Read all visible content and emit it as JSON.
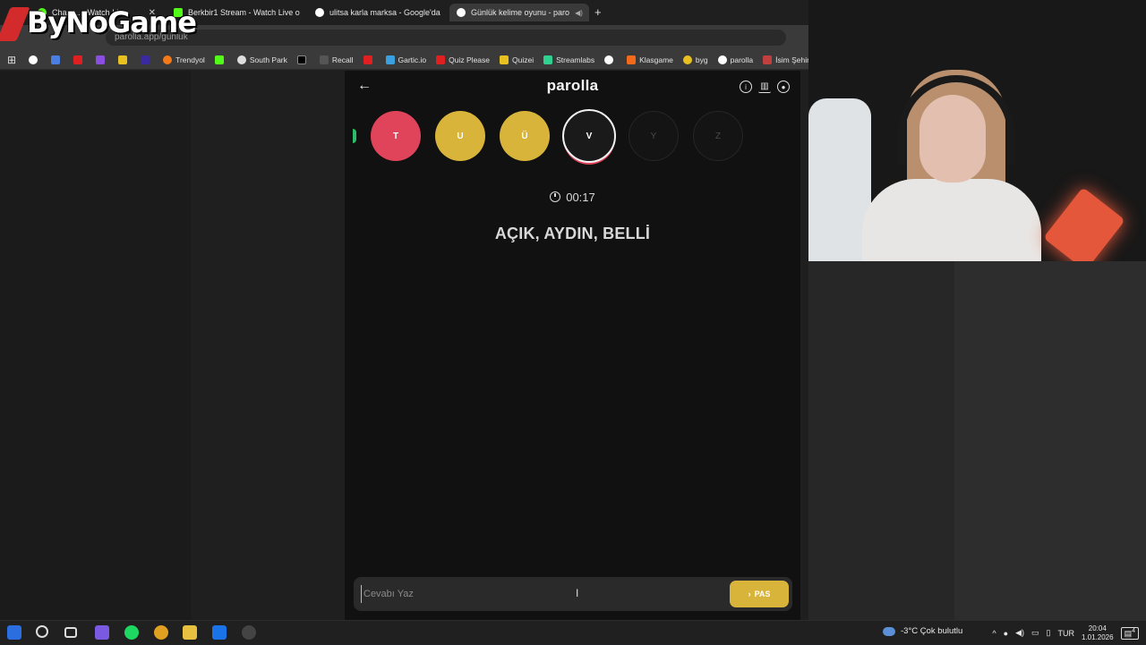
{
  "browser": {
    "tabs": [
      {
        "label": "Chan ... - Watch Live",
        "active": false
      },
      {
        "label": "Berkbir1 Stream - Watch Live o",
        "active": false
      },
      {
        "label": "ulitsa karla marksa - Google'da",
        "active": false
      },
      {
        "label": "Günlük kelime oyunu - paro",
        "active": true
      }
    ],
    "url": "parolla.app/gunluk",
    "bookmarks": [
      "Trendyol",
      "South Park",
      "Recall",
      "Gartic.io",
      "Quiz Please",
      "Quizei",
      "Streamlabs",
      "Klasgame",
      "byg",
      "parolla",
      "İsim Şehir Katman"
    ]
  },
  "overlay": {
    "logo_text": "ByNoGame"
  },
  "app": {
    "brand": "parolla",
    "letters": [
      {
        "letter": "T",
        "state": "wrong"
      },
      {
        "letter": "U",
        "state": "passed"
      },
      {
        "letter": "Ü",
        "state": "passed"
      },
      {
        "letter": "V",
        "state": "current"
      },
      {
        "letter": "Y",
        "state": "future"
      },
      {
        "letter": "Z",
        "state": "future"
      }
    ],
    "timer": "00:17",
    "clue": "AÇIK, AYDIN, BELLİ",
    "answer_placeholder": "Cevabı Yaz",
    "pass_label": "PAS",
    "colors": {
      "wrong": "#e0445a",
      "passed": "#d8b43a",
      "correct": "#2bbd6e"
    }
  },
  "taskbar": {
    "weather": "-3°C  Çok bulutlu",
    "lang": "TUR",
    "time": "20:04",
    "date": "1.01.2026",
    "notifications": "4"
  }
}
